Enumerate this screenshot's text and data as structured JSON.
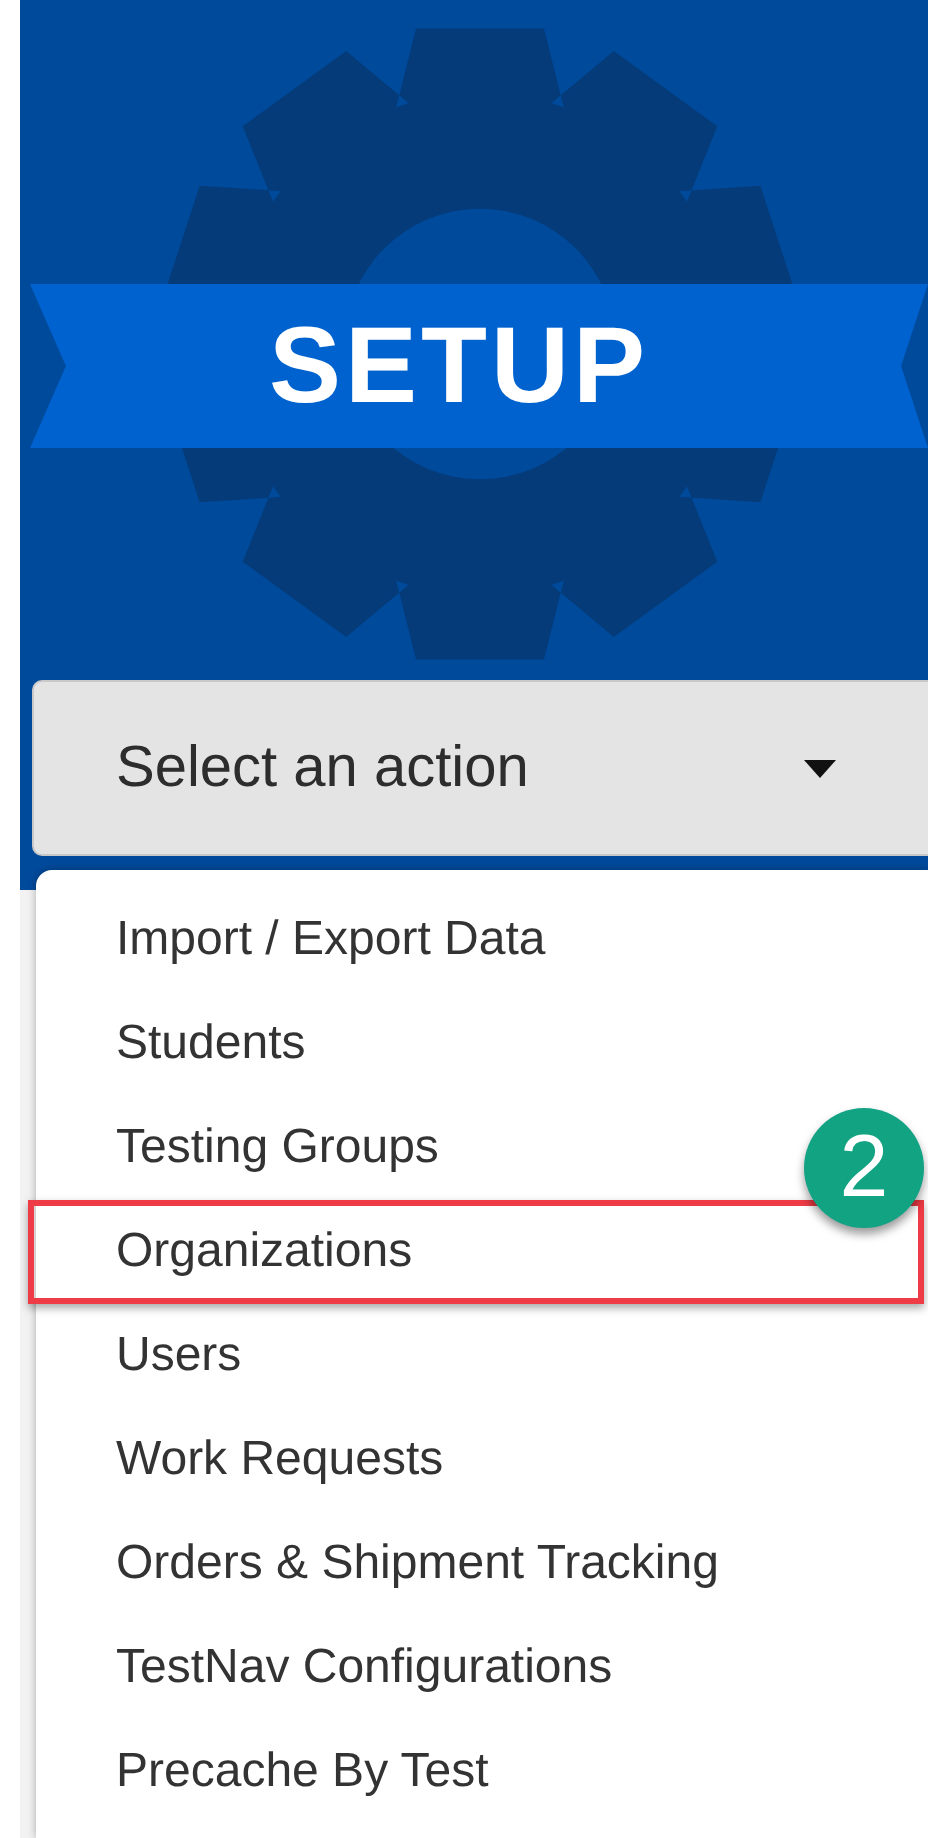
{
  "header": {
    "title": "SETUP"
  },
  "action_select": {
    "placeholder": "Select an action"
  },
  "menu_items": [
    {
      "label": "Import / Export Data",
      "highlighted": false
    },
    {
      "label": "Students",
      "highlighted": false
    },
    {
      "label": "Testing Groups",
      "highlighted": false
    },
    {
      "label": "Organizations",
      "highlighted": true
    },
    {
      "label": "Users",
      "highlighted": false
    },
    {
      "label": "Work Requests",
      "highlighted": false
    },
    {
      "label": "Orders & Shipment Tracking",
      "highlighted": false
    },
    {
      "label": "TestNav Configurations",
      "highlighted": false
    },
    {
      "label": "Precache By Test",
      "highlighted": false
    }
  ],
  "callout": {
    "label": "2"
  }
}
